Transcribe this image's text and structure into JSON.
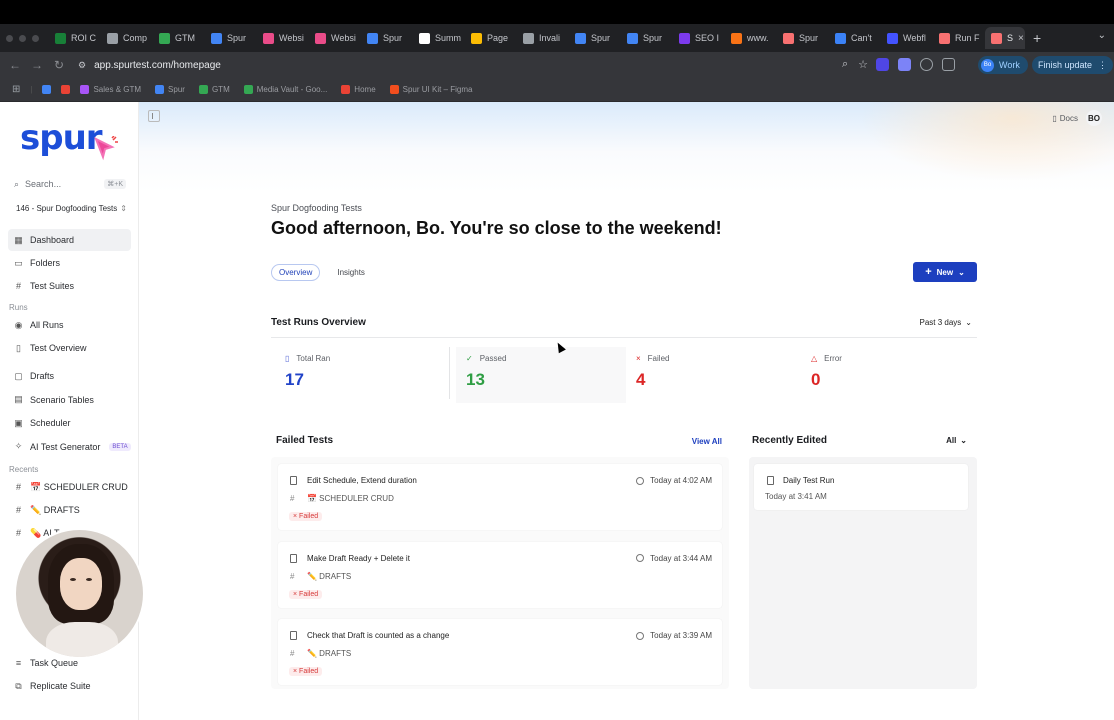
{
  "browser": {
    "tabs": [
      {
        "label": "ROI C",
        "color": "#188038"
      },
      {
        "label": "Comp",
        "color": "#9aa0a6"
      },
      {
        "label": "GTM",
        "color": "#34a853"
      },
      {
        "label": "Spur",
        "color": "#4285f4"
      },
      {
        "label": "Websi",
        "color": "#ea4c89"
      },
      {
        "label": "Websi",
        "color": "#ea4c89"
      },
      {
        "label": "Spur",
        "color": "#4285f4"
      },
      {
        "label": "Summ",
        "color": "#ffffff"
      },
      {
        "label": "Page",
        "color": "#fbbc04"
      },
      {
        "label": "Invali",
        "color": "#9aa0a6"
      },
      {
        "label": "Spur",
        "color": "#4285f4"
      },
      {
        "label": "Spur",
        "color": "#4285f4"
      },
      {
        "label": "SEO I",
        "color": "#7c3aed"
      },
      {
        "label": "www.",
        "color": "#f97316"
      },
      {
        "label": "Spur",
        "color": "#f87171"
      },
      {
        "label": "Can't",
        "color": "#3b82f6"
      },
      {
        "label": "Webfl",
        "color": "#4353ff"
      },
      {
        "label": "Run F",
        "color": "#f87171"
      },
      {
        "label": "S",
        "color": "#f87171"
      }
    ],
    "url": "app.spurtest.com/homepage",
    "work_label": "Work",
    "work_avatar": "Bo",
    "finish_update_label": "Finish update",
    "bookmarks": [
      {
        "label": "Sales & GTM",
        "color": "#a855f7"
      },
      {
        "label": "Spur",
        "color": "#4285f4"
      },
      {
        "label": "GTM",
        "color": "#34a853"
      },
      {
        "label": "Media Vault - Goo...",
        "color": "#34a853"
      },
      {
        "label": "Home",
        "color": "#ea4335"
      },
      {
        "label": "Spur UI Kit – Figma",
        "color": "#f24e1e"
      }
    ]
  },
  "sidebar": {
    "logo": "spur",
    "search_placeholder": "Search...",
    "search_shortcut": "⌘+K",
    "project": "146 - Spur Dogfooding Tests",
    "items_top": [
      {
        "label": "Dashboard",
        "icon": "dashboard-icon",
        "active": true
      },
      {
        "label": "Folders",
        "icon": "folder-icon"
      },
      {
        "label": "Test Suites",
        "icon": "hash-icon"
      }
    ],
    "runs_section": "Runs",
    "items_runs": [
      {
        "label": "All Runs",
        "icon": "play-circle-icon"
      },
      {
        "label": "Test Overview",
        "icon": "document-icon"
      }
    ],
    "items_tools": [
      {
        "label": "Drafts",
        "icon": "draft-icon"
      },
      {
        "label": "Scenario Tables",
        "icon": "table-icon"
      },
      {
        "label": "Scheduler",
        "icon": "calendar-icon"
      },
      {
        "label": "AI Test Generator",
        "icon": "sparkle-icon",
        "badge": "BETA"
      }
    ],
    "recents_section": "Recents",
    "recents": [
      {
        "label": "📅 SCHEDULER CRUD"
      },
      {
        "label": "✏️ DRAFTS"
      },
      {
        "label": "💊 AI Te... Meth"
      }
    ],
    "items_bottom": [
      {
        "label": "Task Queue",
        "icon": "list-icon"
      },
      {
        "label": "Replicate Suite",
        "icon": "copy-icon"
      }
    ]
  },
  "header": {
    "docs_label": "Docs",
    "avatar": "BO"
  },
  "main": {
    "project_name": "Spur Dogfooding Tests",
    "greeting": "Good afternoon, Bo. You're so close to the weekend!",
    "tabs": [
      "Overview",
      "Insights"
    ],
    "new_button": "New",
    "overview_title": "Test Runs Overview",
    "range_label": "Past 3 days",
    "stats": [
      {
        "label": "Total Ran",
        "value": "17",
        "color": "#2143c8",
        "icon": "document-icon"
      },
      {
        "label": "Passed",
        "value": "13",
        "color": "#2f9e44",
        "icon": "check-icon"
      },
      {
        "label": "Failed",
        "value": "4",
        "color": "#dc2626",
        "icon": "x-icon"
      },
      {
        "label": "Error",
        "value": "0",
        "color": "#dc2626",
        "icon": "warning-icon"
      }
    ],
    "failed_tests": {
      "title": "Failed Tests",
      "view_all": "View All",
      "items": [
        {
          "title": "Edit Schedule, Extend duration",
          "suite": "📅 SCHEDULER CRUD",
          "status": "Failed",
          "time": "Today at 4:02 AM"
        },
        {
          "title": "Make Draft Ready + Delete it",
          "suite": "✏️ DRAFTS",
          "status": "Failed",
          "time": "Today at 3:44 AM"
        },
        {
          "title": "Check that Draft is counted as a change",
          "suite": "✏️ DRAFTS",
          "status": "Failed",
          "time": "Today at 3:39 AM"
        }
      ]
    },
    "recently_edited": {
      "title": "Recently Edited",
      "filter": "All",
      "items": [
        {
          "title": "Daily Test Run",
          "time": "Today at 3:41 AM"
        }
      ]
    }
  }
}
